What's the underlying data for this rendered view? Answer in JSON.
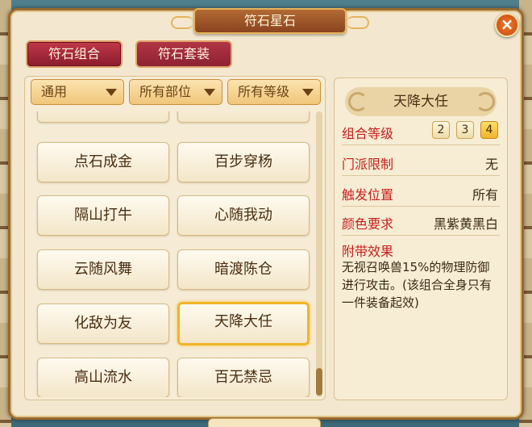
{
  "window": {
    "title": "符石星石",
    "close_label": "×"
  },
  "tabs": [
    {
      "label": "符石组合",
      "active": true
    },
    {
      "label": "符石套装",
      "active": false
    }
  ],
  "filters": [
    {
      "label": "通用"
    },
    {
      "label": "所有部位"
    },
    {
      "label": "所有等级"
    }
  ],
  "combos": [
    {
      "label": "点石成金"
    },
    {
      "label": "百步穿杨"
    },
    {
      "label": "隔山打牛"
    },
    {
      "label": "心随我动"
    },
    {
      "label": "云随风舞"
    },
    {
      "label": "暗渡陈仓"
    },
    {
      "label": "化敌为友"
    },
    {
      "label": "天降大任",
      "selected": true
    },
    {
      "label": "高山流水"
    },
    {
      "label": "百无禁忌"
    }
  ],
  "detail": {
    "name": "天降大任",
    "level_label": "组合等级",
    "levels": [
      "2",
      "3",
      "4"
    ],
    "active_level": "4",
    "school_label": "门派限制",
    "school_value": "无",
    "trigger_label": "触发位置",
    "trigger_value": "所有",
    "color_label": "颜色要求",
    "color_value": "黑紫黄黑白",
    "effect_label": "附带效果",
    "effect_text": "无视召唤兽15%的物理防御进行攻击。(该组合全身只有一件装备起效)"
  },
  "colors": {
    "accent": "#c8201e",
    "tab": "#a02a3a",
    "selected_border": "#f0b428"
  }
}
